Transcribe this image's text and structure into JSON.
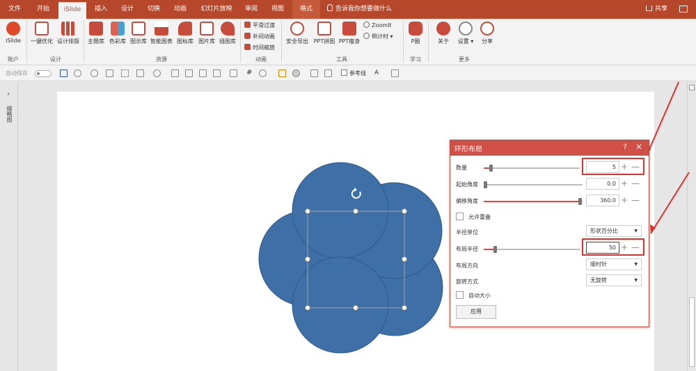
{
  "tabs": [
    "文件",
    "开始",
    "iSlide",
    "插入",
    "设计",
    "切换",
    "动画",
    "幻灯片放映",
    "审阅",
    "视图",
    "格式"
  ],
  "active_tab": "iSlide",
  "tellme": "告诉我你想要做什么",
  "share": "共享",
  "ribbon": {
    "islide": "iSlide",
    "one_click": "一键优化",
    "design_layout": "设计排版",
    "theme_lib": "主题库",
    "color_lib": "色彩库",
    "diagram_lib": "图示库",
    "smart_chart": "智能图表",
    "icon_lib": "图标库",
    "pic_lib": "图片库",
    "illus_lib": "插图库",
    "smooth": "平滑过渡",
    "tween": "补间动画",
    "time_zoom": "时间缩放",
    "safe_export": "安全导出",
    "ppt_join": "PPT拼图",
    "ppt_slim": "PPT瘦身",
    "zoomit": "ZoomIt",
    "countdown": "倒计时",
    "pcircle": "P圈",
    "about": "关于",
    "settings": "设置",
    "share": "分享",
    "groups": {
      "account": "账户",
      "design": "设计",
      "resources": "资源",
      "animation": "动画",
      "tools": "工具",
      "learn": "学习",
      "more": "更多"
    }
  },
  "qat": {
    "autosave": "自动保存",
    "guideline": "参考线"
  },
  "left_pane_label": "缩略图",
  "panel": {
    "title": "环形布局",
    "help": "?",
    "close": "×",
    "count_label": "数量",
    "count_value": "5",
    "start_angle_label": "起始角度",
    "start_angle_value": "0.0",
    "offset_angle_label": "偏移角度",
    "offset_angle_value": "360.0",
    "allow_overlap_label": "允许重叠",
    "radius_unit_label": "半径单位",
    "radius_unit_value": "形状百分比",
    "layout_radius_label": "布局半径",
    "layout_radius_value": "50",
    "direction_label": "布局方向",
    "direction_value": "顺时针",
    "rotation_label": "旋转方式",
    "rotation_value": "无旋转",
    "autosize_label": "自动大小",
    "apply_label": "应用",
    "plus": "+",
    "minus": "—"
  },
  "colors": {
    "accent": "#b7472a",
    "panel_header": "#d05048",
    "circle_fill": "#3e6fa6",
    "highlight": "#e0302a"
  }
}
